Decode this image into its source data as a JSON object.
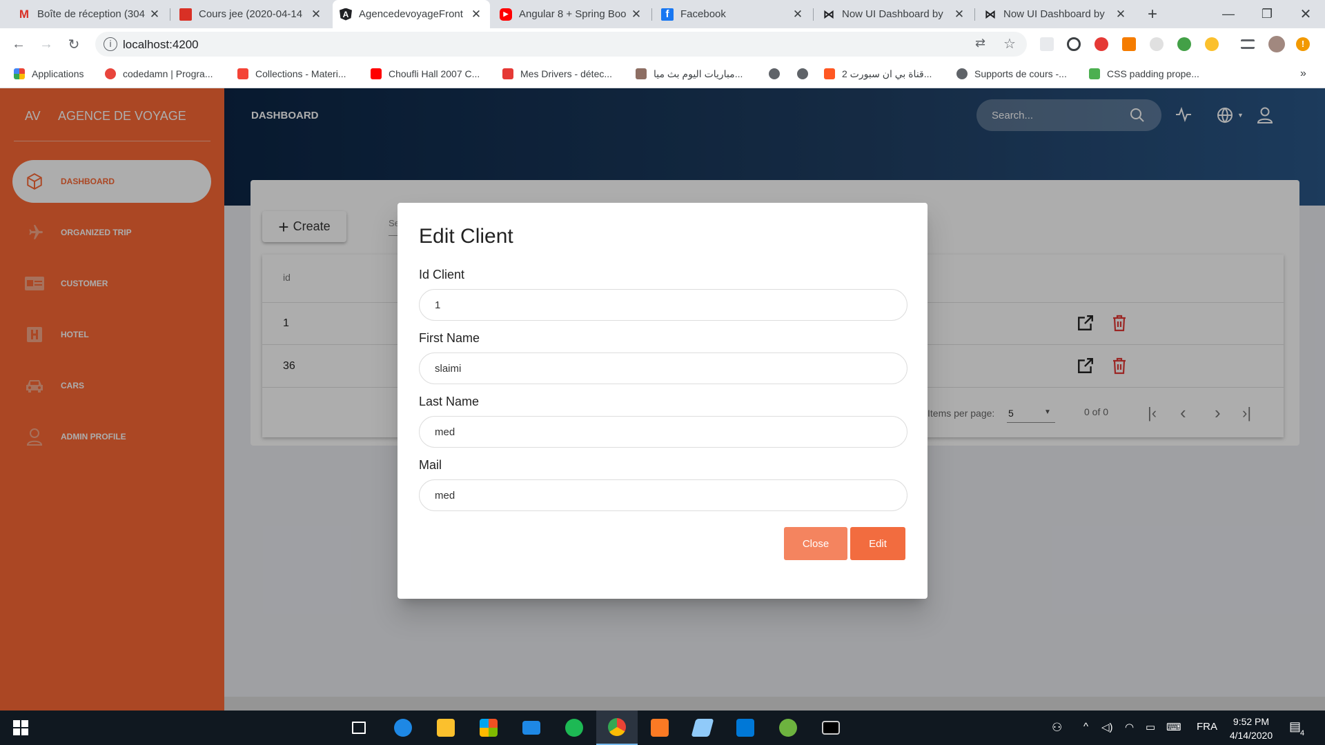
{
  "browser": {
    "tabs": [
      {
        "title": "Boîte de réception (304",
        "icon": "gmail-icon",
        "color": "#d93025"
      },
      {
        "title": "Cours jee (2020-04-14",
        "icon": "calendar-icon",
        "color": "#d93025"
      },
      {
        "title": "AgencedevoyageFront",
        "icon": "angular-icon",
        "color": "#202124"
      },
      {
        "title": "Angular 8 + Spring Boo",
        "icon": "youtube-icon",
        "color": "#ff0000"
      },
      {
        "title": "Facebook",
        "icon": "facebook-icon",
        "color": "#1877f2"
      },
      {
        "title": "Now UI Dashboard by",
        "icon": "bowtie-icon",
        "color": "#202124"
      },
      {
        "title": "Now UI Dashboard by",
        "icon": "bowtie-icon",
        "color": "#202124"
      }
    ],
    "new_tab": "+",
    "url": "localhost:4200",
    "bookmarks": [
      {
        "label": "Applications",
        "color": "#4285f4"
      },
      {
        "label": "codedamn | Progra...",
        "color": "#e8453c"
      },
      {
        "label": "Collections - Materi...",
        "color": "#f44336"
      },
      {
        "label": "Choufli Hall 2007 C...",
        "color": "#ff0000"
      },
      {
        "label": "Mes Drivers - détec...",
        "color": "#e53935"
      },
      {
        "label": "مباريات اليوم بث ميا...",
        "color": "#8d6e63"
      },
      {
        "label": "",
        "color": "#5f6368"
      },
      {
        "label": "",
        "color": "#5f6368"
      },
      {
        "label": "قناة بي ان سبورت 2...",
        "color": "#ff5722"
      },
      {
        "label": "Supports de cours -...",
        "color": "#5f6368"
      },
      {
        "label": "CSS padding prope...",
        "color": "#4caf50"
      }
    ],
    "bookmarks_more": "»"
  },
  "sidebar": {
    "logo_mini": "AV",
    "logo_text": "AGENCE DE VOYAGE",
    "items": [
      {
        "label": "DASHBOARD",
        "icon": "box-icon",
        "active": true
      },
      {
        "label": "ORGANIZED TRIP",
        "icon": "airplane-icon",
        "active": false
      },
      {
        "label": "CUSTOMER",
        "icon": "id-card-icon",
        "active": false
      },
      {
        "label": "HOTEL",
        "icon": "hotel-icon",
        "active": false
      },
      {
        "label": "CARS",
        "icon": "car-icon",
        "active": false
      },
      {
        "label": "ADMIN PROFILE",
        "icon": "user-icon",
        "active": false
      }
    ]
  },
  "header": {
    "brand": "DASHBOARD",
    "search_placeholder": "Search..."
  },
  "table": {
    "create_label": "Create",
    "filter_placeholder": "Se",
    "column_id": "id",
    "rows": [
      {
        "id": "1"
      },
      {
        "id": "36"
      }
    ],
    "items_per_page_label": "Items per page:",
    "items_per_page_value": "5",
    "range_label": "0 of 0"
  },
  "dialog": {
    "title": "Edit Client",
    "fields": [
      {
        "label": "Id Client",
        "value": "1"
      },
      {
        "label": "First Name",
        "value": "slaimi"
      },
      {
        "label": "Last Name",
        "value": "med"
      },
      {
        "label": "Mail",
        "value": "med"
      }
    ],
    "close_label": "Close",
    "edit_label": "Edit"
  },
  "taskbar": {
    "language": "FRA",
    "time": "9:52 PM",
    "date": "4/14/2020",
    "notifications": "4"
  },
  "colors": {
    "sidebar": "#fc6935",
    "header_dark": "#0c2646",
    "close_button": "#f4845f",
    "edit_button": "#f26c3f",
    "delete_icon": "#e53935"
  }
}
